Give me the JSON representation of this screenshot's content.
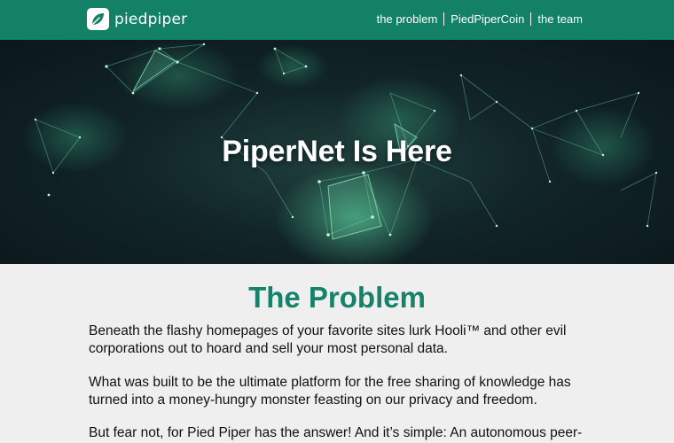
{
  "brand": {
    "logo_text": "piedpiper",
    "nav_color": "#138165",
    "accent_color": "#16826a",
    "logo_icon": "leaf-icon"
  },
  "nav": {
    "links": [
      {
        "label": "the problem"
      },
      {
        "label": "PiedPiperCoin"
      },
      {
        "label": "the team"
      }
    ]
  },
  "hero": {
    "title": "PiperNet Is Here"
  },
  "problem": {
    "title": "The Problem",
    "paragraphs": [
      "Beneath the flashy homepages of your favorite sites lurk Hooli™ and other evil corporations out to hoard and sell your most personal data.",
      "What was built to be the ultimate platform for the free sharing of knowledge has turned into a money-hungry monster feasting on our privacy and freedom.",
      "But fear not, for Pied Piper has the answer! And it’s simple: An autonomous peer-to-peer network for a decentralized internet, powered by our users."
    ]
  }
}
